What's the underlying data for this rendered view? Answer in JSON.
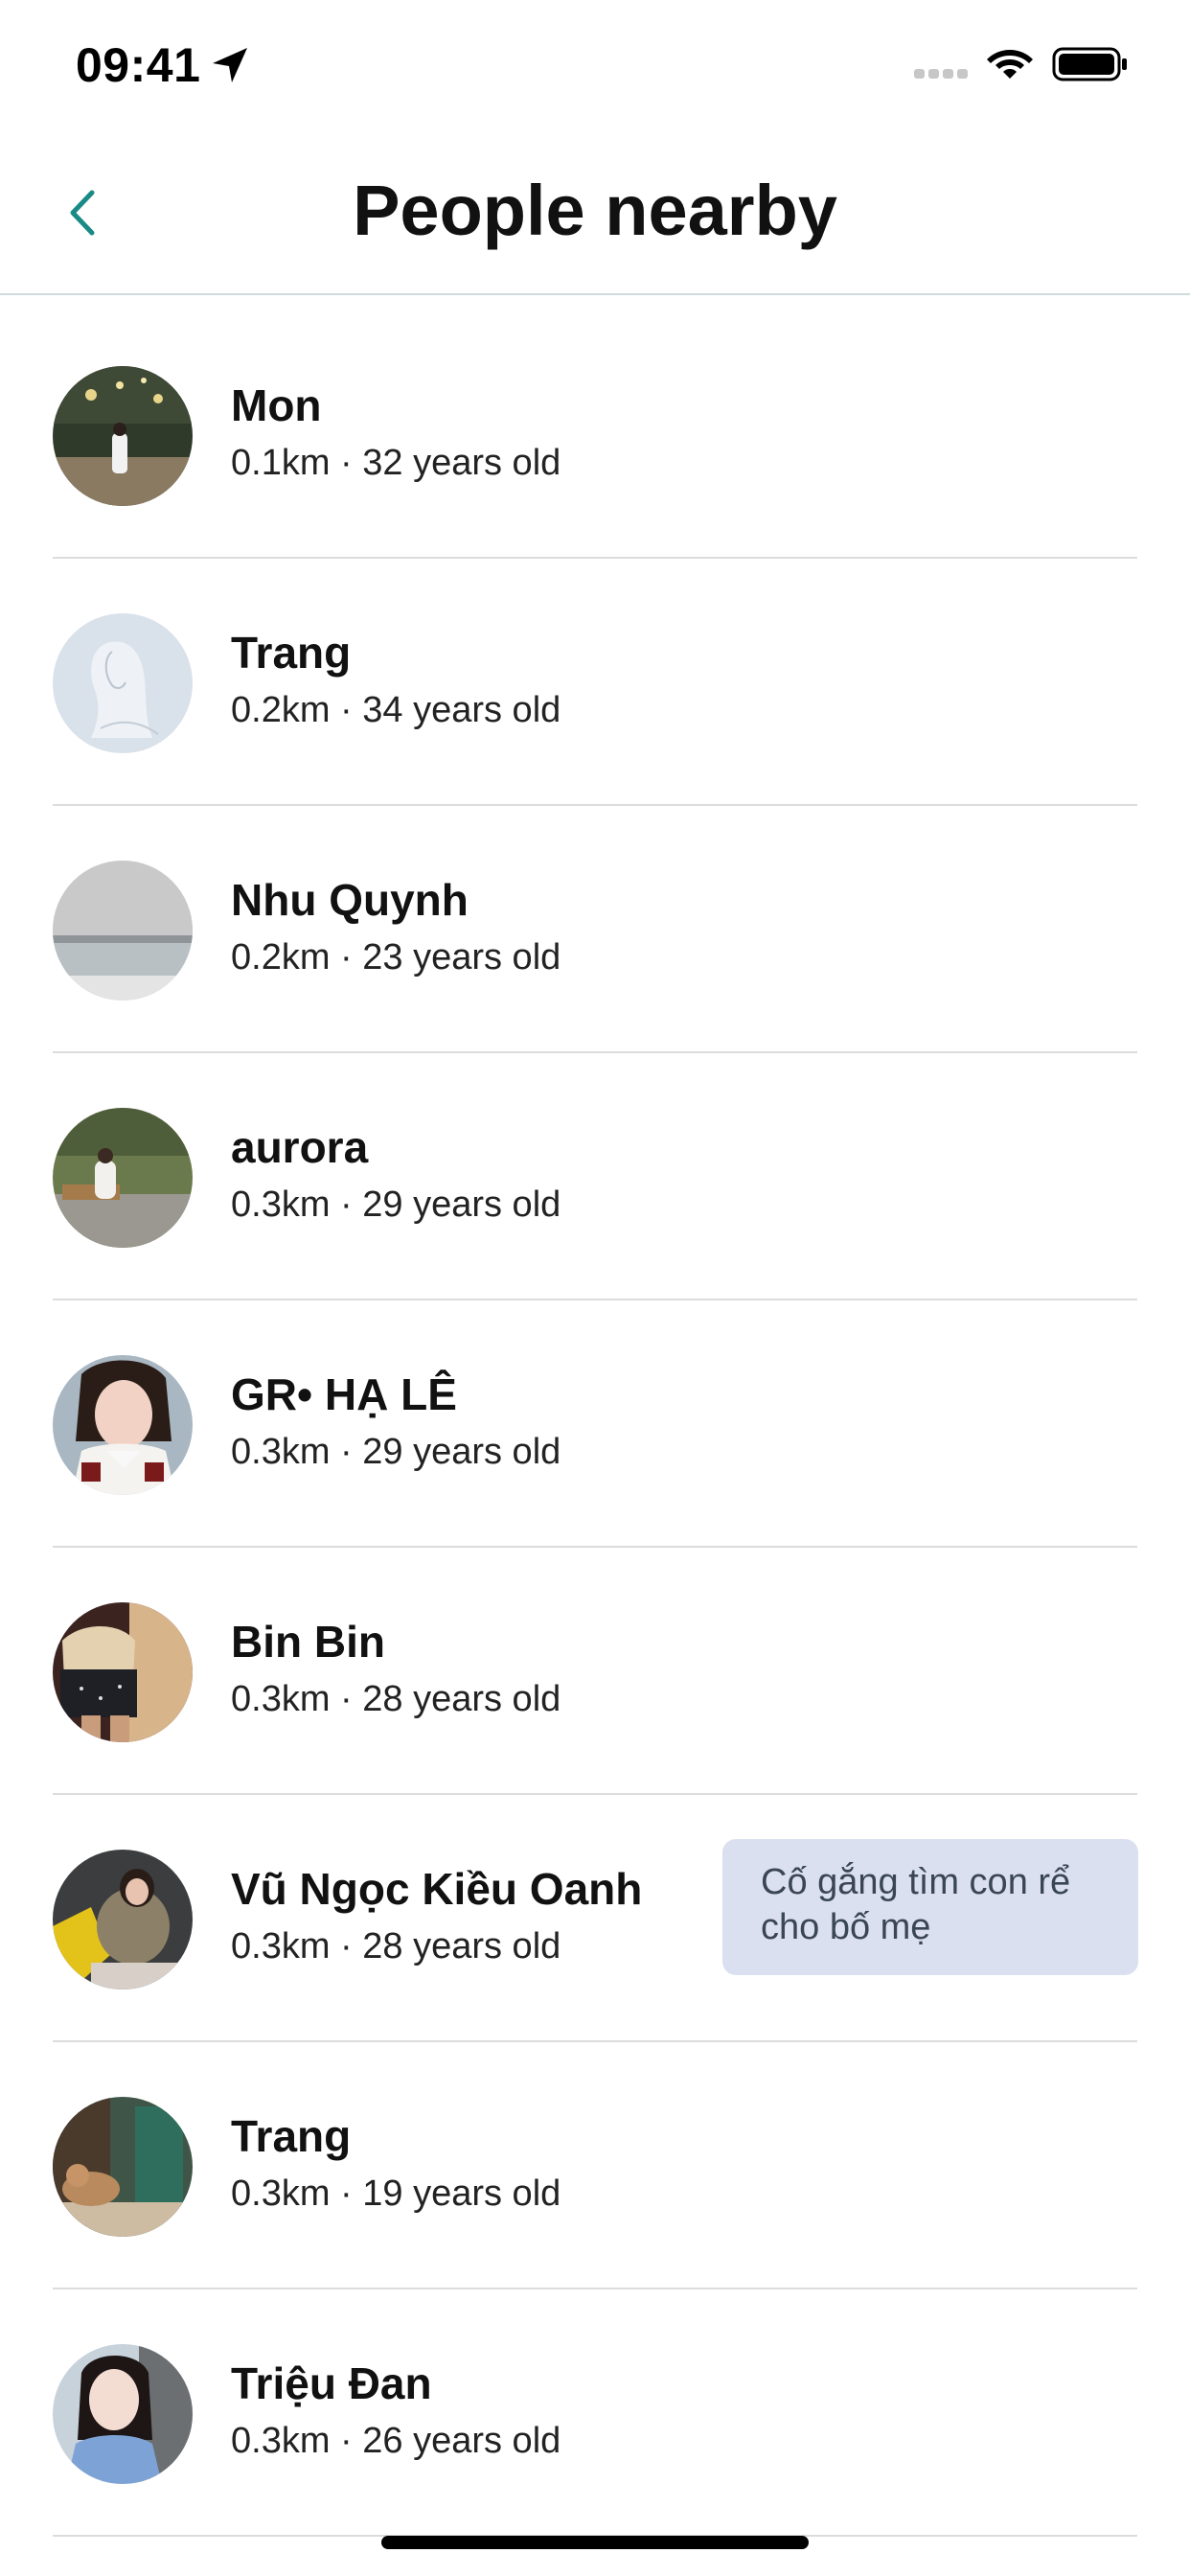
{
  "status_bar": {
    "time": "09:41"
  },
  "header": {
    "title": "People nearby",
    "back_icon": "chevron-left-icon",
    "accent_color": "#1a8a86"
  },
  "people": [
    {
      "name": "Mon",
      "meta": "0.1km · 32 years old"
    },
    {
      "name": "Trang",
      "meta": "0.2km · 34 years old"
    },
    {
      "name": "Nhu Quynh",
      "meta": "0.2km · 23 years old"
    },
    {
      "name": "aurora",
      "meta": "0.3km · 29 years old"
    },
    {
      "name": "GR• HẠ LÊ",
      "meta": "0.3km · 29 years old"
    },
    {
      "name": "Bin Bin",
      "meta": "0.3km · 28 years old"
    },
    {
      "name": "Vũ Ngọc Kiều Oanh",
      "meta": "0.3km · 28 years old",
      "bio": "Cố gắng tìm con rể cho bố mẹ"
    },
    {
      "name": "Trang",
      "meta": "0.3km · 19 years old"
    },
    {
      "name": "Triệu Đan",
      "meta": "0.3km · 26 years old"
    }
  ]
}
